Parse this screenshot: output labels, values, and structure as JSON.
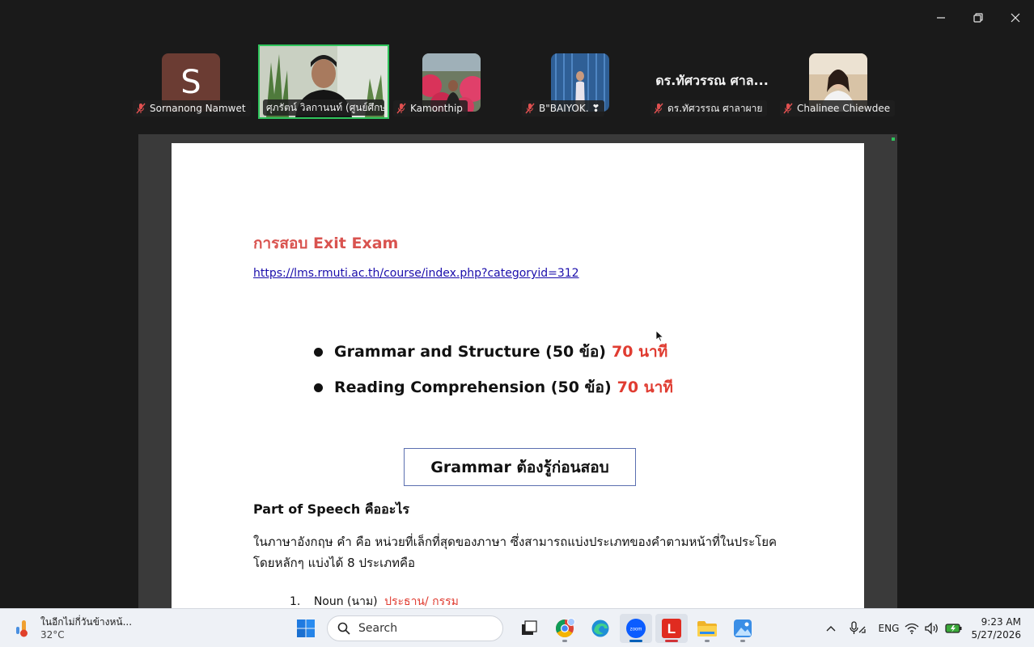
{
  "participants": [
    {
      "name": "Sornanong Namwet",
      "avatar_letter": "S"
    },
    {
      "name": "ศุภรัตน์ วิลกานนท์ (ศูนย์ศึกษา..."
    },
    {
      "name": "Kamonthip"
    },
    {
      "name": "B\"BAIYOK. ❣"
    },
    {
      "name": "ดร.ทัศวรรณ ศาลาผาย",
      "display_title": "ดร.ทัศวรรณ ศาล..."
    },
    {
      "name": "Chalinee Chiewdee"
    }
  ],
  "document": {
    "title": "การสอบ Exit Exam",
    "link": "https://lms.rmuti.ac.th/course/index.php?categoryid=312",
    "bullets": [
      {
        "text": "Grammar and Structure (50 ข้อ)",
        "time": "70 นาที"
      },
      {
        "text": "Reading Comprehension (50 ข้อ)",
        "time": "70 นาที"
      }
    ],
    "box_heading": "Grammar ต้องรู้ก่อนสอบ",
    "sub_heading": "Part of Speech คืออะไร",
    "paragraph_line1": "ในภาษาอังกฤษ  คำ  คือ  หน่วยที่เล็กที่สุดของภาษา  ซึ่งสามารถแบ่งประเภทของคำตามหน้าที่ในประโยค",
    "paragraph_line2": "โดยหลักๆ แบ่งได้ 8 ประเภทคือ",
    "list": [
      {
        "num": "1.",
        "term": "Noun (นาม)",
        "meaning": "ประธาน/ กรรม"
      }
    ]
  },
  "taskbar": {
    "weather_text": "ในอีกไม่กี่วันข้างหน้...",
    "weather_temp": "32°C",
    "search_placeholder": "Search",
    "language": "ENG",
    "time": "9:23 AM",
    "date": "5/27/2026"
  },
  "colors": {
    "accent_red": "#e03c31",
    "active_border": "#2fc45c",
    "link": "#1a0dab"
  }
}
